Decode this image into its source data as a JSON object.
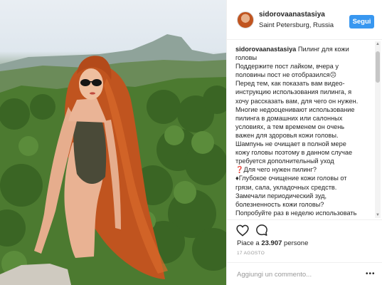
{
  "post": {
    "username": "sidorovaanastasiya",
    "location": "Saint Petersburg, Russia",
    "follow_label": "Segui"
  },
  "caption": {
    "author": "sidorovaanastasiya",
    "lines": [
      " Пилинг для кожи",
      "головы",
      "Поддержите пост лайком, вчера у",
      "половины пост не отобразился☹",
      "Перед тем, как показать вам видео-",
      "инструкцию использования пилинга, я",
      "хочу рассказать вам, для чего он нужен.",
      "Многие недооценивают использование",
      "пилинга в домашних или салонных",
      "условиях, а тем временем он очень",
      "важен для здоровья кожи головы.",
      "Шампунь не очищает в полной мере",
      "кожу головы поэтому в данном случае",
      "требуется дополнительный уход",
      "❓Для чего нужен пилинг?",
      "♦Глубокое очищение кожи головы от",
      "грязи, сала, укладочных средств.",
      "Замечали периодический зуд,",
      "болезненность кожи головы?",
      "Попробуйте раз в неделю использовать"
    ]
  },
  "likes": {
    "prefix": "Piace a ",
    "count": "23.907",
    "suffix": " persone"
  },
  "date": "17 AGOSTO",
  "comment": {
    "placeholder": "Aggiungi un commento..."
  },
  "icons": {
    "like": "heart-icon",
    "comment": "comment-icon",
    "more": "more-options-icon"
  },
  "colors": {
    "follow_button": "#3897f0",
    "hair": "#c0541f",
    "text": "#262626"
  }
}
